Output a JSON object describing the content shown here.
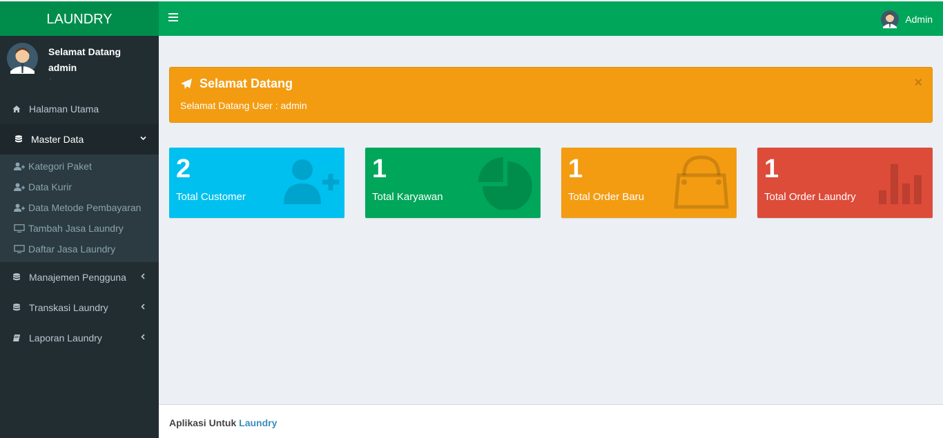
{
  "header": {
    "logo": "LAUNDRY",
    "user_name": "Admin"
  },
  "sidebar": {
    "welcome": "Selamat Datang",
    "username": "admin",
    "menu": {
      "home": "Halaman Utama",
      "master": "Master Data",
      "sub": [
        "Kategori Paket",
        "Data Kurir",
        "Data Metode Pembayaran",
        "Tambah Jasa Laundry",
        "Daftar Jasa Laundry"
      ],
      "users": "Manajemen Pengguna",
      "trans": "Transkasi Laundry",
      "report": "Laporan Laundry"
    }
  },
  "callout": {
    "title": "Selamat Datang",
    "text": "Selamat Datang User : admin",
    "close": "×"
  },
  "stats": [
    {
      "value": "2",
      "label": "Total Customer"
    },
    {
      "value": "1",
      "label": "Total Karyawan"
    },
    {
      "value": "1",
      "label": "Total Order Baru"
    },
    {
      "value": "1",
      "label": "Total Order Laundry"
    }
  ],
  "footer": {
    "prefix": "Aplikasi Untuk",
    "link": "Laundry"
  },
  "colors": {
    "navbar": "#00a65a",
    "logo": "#008d4c",
    "sidebar": "#222d32",
    "aqua": "#00c0ef",
    "green": "#00a65a",
    "yellow": "#f39c12",
    "red": "#dd4b39"
  }
}
